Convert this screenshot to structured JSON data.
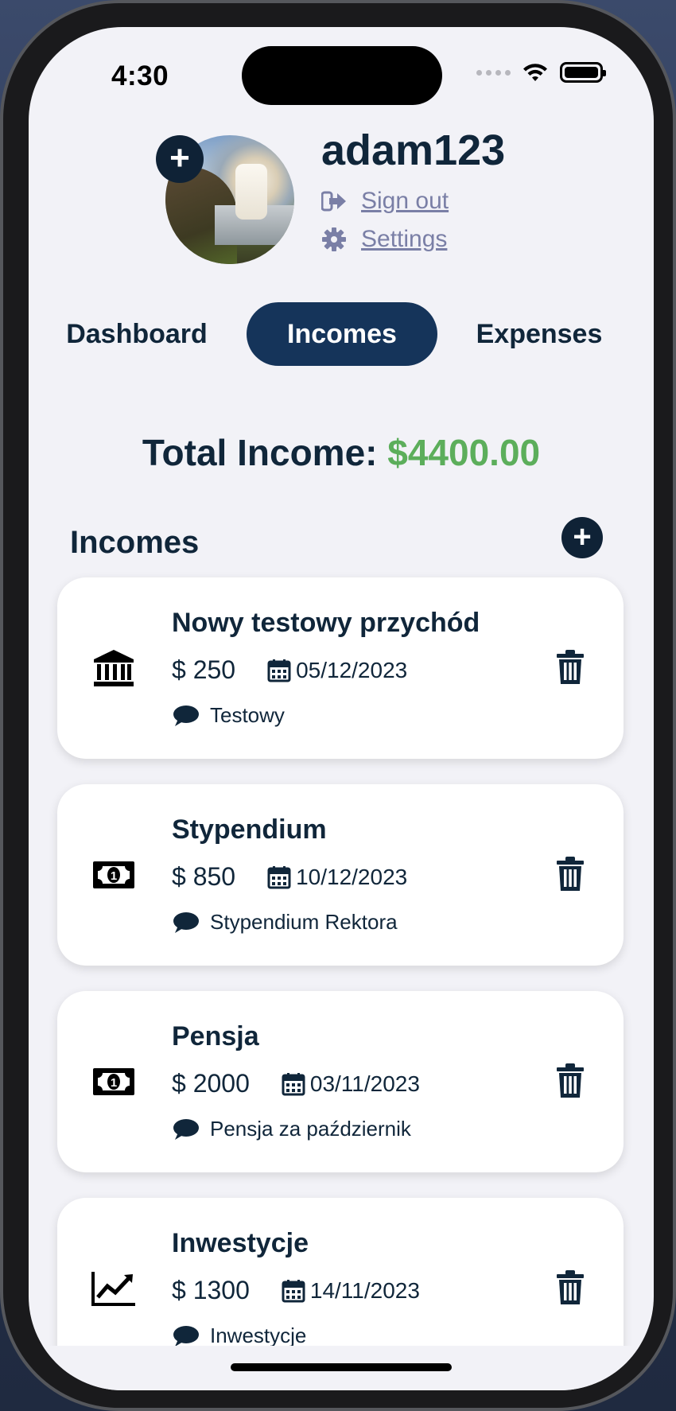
{
  "status_bar": {
    "time": "4:30"
  },
  "profile": {
    "username": "adam123",
    "sign_out_label": "Sign out",
    "settings_label": "Settings"
  },
  "tabs": [
    {
      "label": "Dashboard",
      "active": false
    },
    {
      "label": "Incomes",
      "active": true
    },
    {
      "label": "Expenses",
      "active": false
    }
  ],
  "total": {
    "label": "Total Income:",
    "amount": "$4400.00"
  },
  "section": {
    "title": "Incomes"
  },
  "incomes": [
    {
      "title": "Nowy testowy przychód",
      "amount": "$ 250",
      "date": "05/12/2023",
      "note": "Testowy",
      "icon": "bank-icon"
    },
    {
      "title": "Stypendium",
      "amount": "$ 850",
      "date": "10/12/2023",
      "note": "Stypendium Rektora",
      "icon": "money-bill-icon"
    },
    {
      "title": "Pensja",
      "amount": "$ 2000",
      "date": "03/11/2023",
      "note": "Pensja za październik",
      "icon": "money-bill-icon"
    },
    {
      "title": "Inwestycje",
      "amount": "$ 1300",
      "date": "14/11/2023",
      "note": "Inwestycje",
      "icon": "chart-line-icon"
    }
  ],
  "colors": {
    "primary": "#10263a",
    "active_tab": "#15345a",
    "income_green": "#5cae5b",
    "link": "#7a7fa6",
    "background": "#f2f2f7"
  }
}
